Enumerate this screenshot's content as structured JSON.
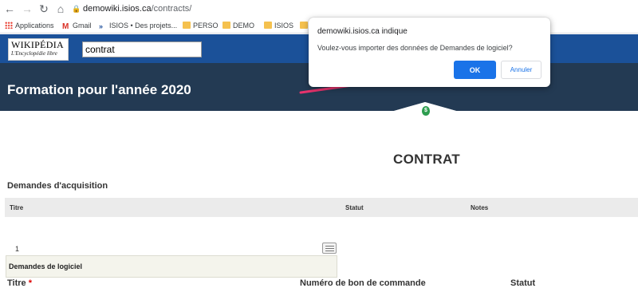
{
  "browser": {
    "url_host": "demowiki.isios.ca",
    "url_path": "/contracts/",
    "bookmarks": [
      "Applications",
      "Gmail",
      "ISIOS • Des projets...",
      "PERSO",
      "DEMO",
      "ISIOS"
    ]
  },
  "wiki": {
    "logo_title": "WIKIPÉDIA",
    "logo_subtitle": "L'Encyclopédie libre",
    "search_value": "contrat"
  },
  "banner": {
    "title": "Formation pour l'année 2020"
  },
  "page": {
    "heading": "CONTRAT",
    "section_title": "Demandes d'acquisition",
    "columns": [
      "Titre",
      "Statut",
      "Notes"
    ],
    "row_number": "1",
    "subpanel_title": "Demandes de logiciel",
    "bottom_row": {
      "col1": "Titre",
      "required_marker": "*",
      "col2": "Numéro de bon de commande",
      "col3": "Statut"
    }
  },
  "dialog": {
    "origin": "demowiki.isios.ca indique",
    "message": "Voulez-vous importer des données de Demandes de logiciel?",
    "ok_label": "OK",
    "cancel_label": "Annuler"
  },
  "colors": {
    "wiki_bar": "#1b5199",
    "banner": "#233a53",
    "ok_button": "#1a73e8",
    "arrow": "#e8336d"
  }
}
